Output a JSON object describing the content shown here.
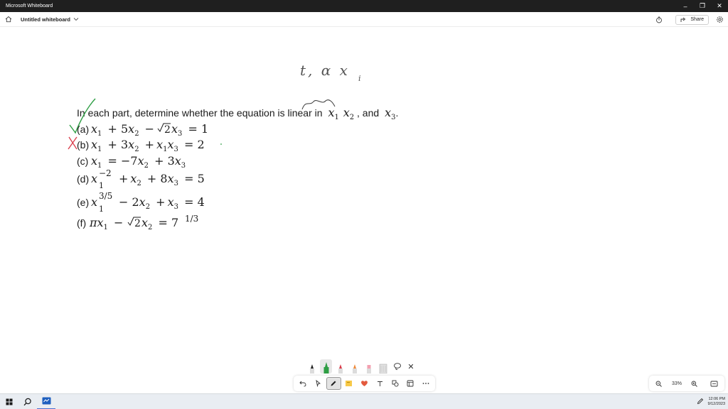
{
  "window": {
    "title": "Microsoft Whiteboard",
    "controls": [
      "–",
      "❐",
      "✕"
    ]
  },
  "header": {
    "board_title": "Untitled whiteboard",
    "share_label": "Share"
  },
  "handwriting": {
    "top_note": "t,  α x"
  },
  "problem": {
    "intro": "In each part, determine whether the equation is linear in",
    "intro_and": ", and",
    "parts": [
      {
        "label": "(a)",
        "mark": "✓"
      },
      {
        "label": "(b)",
        "mark": "X"
      },
      {
        "label": "(c)"
      },
      {
        "label": "(d)"
      },
      {
        "label": "(e)"
      },
      {
        "label": "(f)"
      }
    ]
  },
  "ink_colors": {
    "check": "#2e9e44",
    "cross": "#d93b4a",
    "ink": "#1b1b1b"
  },
  "toolbar": {
    "pens": [
      "black-pen",
      "green-pen",
      "red-pen",
      "orange-pen",
      "highlighter",
      "eraser",
      "lasso"
    ],
    "tools": [
      "undo",
      "select",
      "pen",
      "sticky-note",
      "reaction",
      "text",
      "shapes",
      "template",
      "more"
    ]
  },
  "zoom": {
    "value": "33%"
  },
  "taskbar": {
    "time": "12:06 PM",
    "date": "9/12/2023"
  }
}
